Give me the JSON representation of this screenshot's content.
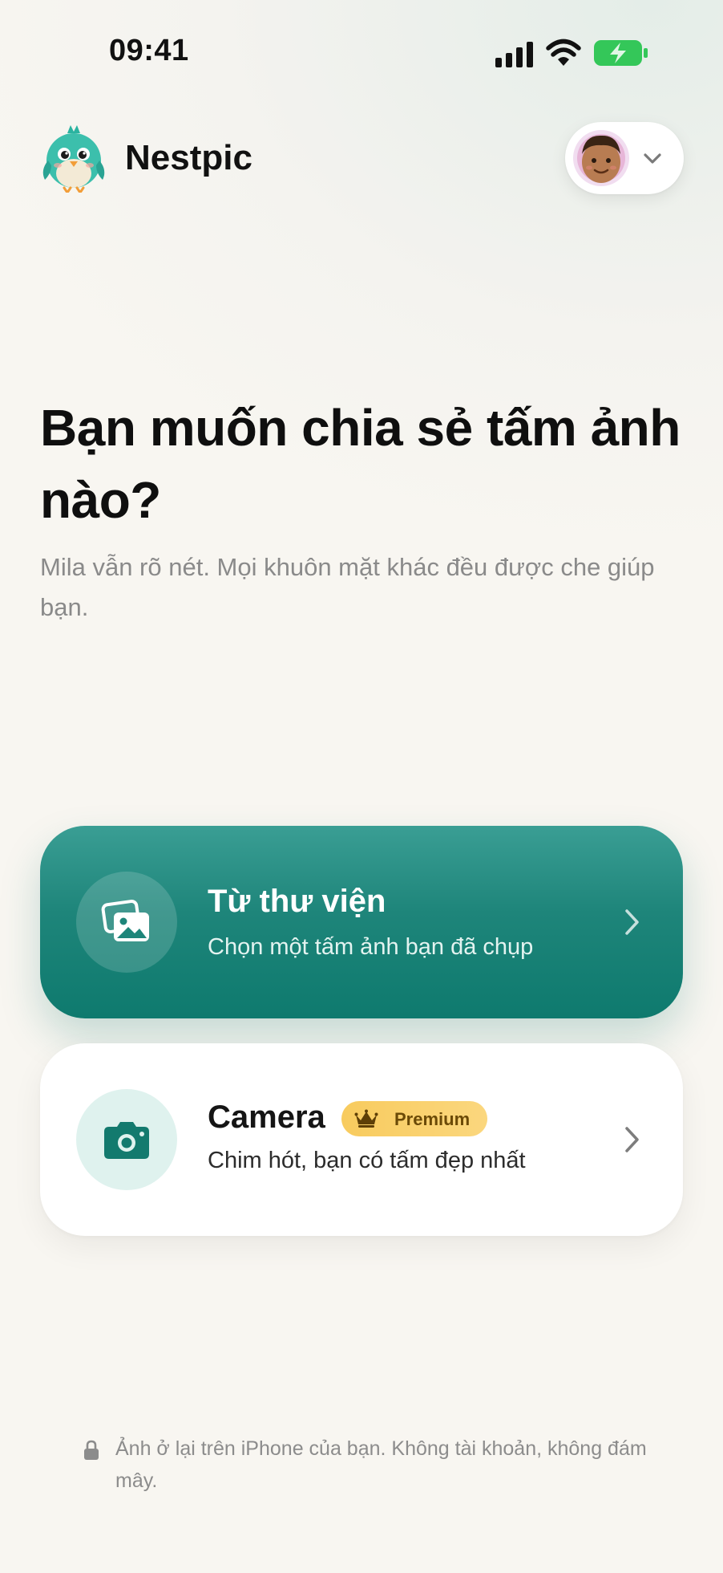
{
  "status_bar": {
    "time": "09:41",
    "icons": [
      "cellular-signal-icon",
      "wifi-icon",
      "battery-charging-icon"
    ]
  },
  "header": {
    "app_name": "Nestpic",
    "logo_icon": "bird-mascot-icon",
    "account_icon": "user-avatar",
    "account_chevron": "chevron-down-icon"
  },
  "main": {
    "headline": "Bạn muốn chia sẻ tấm ảnh nào?",
    "subtitle": "Mila vẫn rõ nét. Mọi khuôn mặt khác đều được che giúp bạn."
  },
  "options": [
    {
      "title": "Từ thư viện",
      "description": "Chọn một tấm ảnh bạn đã chụp",
      "icon": "photo-library-icon"
    },
    {
      "title": "Camera",
      "description": "Chim hót, bạn có tấm đẹp nhất",
      "icon": "camera-icon",
      "badge": "Premium",
      "badge_icon": "crown-icon"
    }
  ],
  "footer": {
    "privacy_text": "Ảnh ở lại trên iPhone của bạn. Không tài khoản, không đám mây.",
    "icon": "lock-icon"
  },
  "colors": {
    "accent_teal": "#1e857a",
    "premium_gold": "#f8cb5e",
    "battery_green": "#34c759",
    "background": "#f8f6f1"
  }
}
